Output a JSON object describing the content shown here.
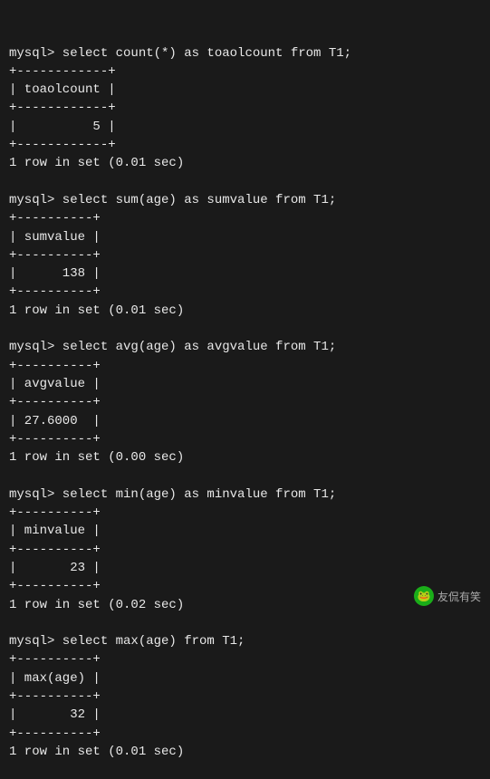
{
  "terminal": {
    "lines": [
      "mysql> select count(*) as toaolcount from T1;",
      "+------------+",
      "| toaolcount |",
      "+------------+",
      "|          5 |",
      "+------------+",
      "1 row in set (0.01 sec)",
      "",
      "mysql> select sum(age) as sumvalue from T1;",
      "+----------+",
      "| sumvalue |",
      "+----------+",
      "|      138 |",
      "+----------+",
      "1 row in set (0.01 sec)",
      "",
      "mysql> select avg(age) as avgvalue from T1;",
      "+----------+",
      "| avgvalue |",
      "+----------+",
      "| 27.6000  |",
      "+----------+",
      "1 row in set (0.00 sec)",
      "",
      "mysql> select min(age) as minvalue from T1;",
      "+----------+",
      "| minvalue |",
      "+----------+",
      "|       23 |",
      "+----------+",
      "1 row in set (0.02 sec)",
      "",
      "mysql> select max(age) from T1;",
      "+----------+",
      "| max(age) |",
      "+----------+",
      "|       32 |",
      "+----------+",
      "1 row in set (0.01 sec)"
    ]
  },
  "watermark": {
    "icon": "🐸",
    "text": "友侃有笑"
  }
}
